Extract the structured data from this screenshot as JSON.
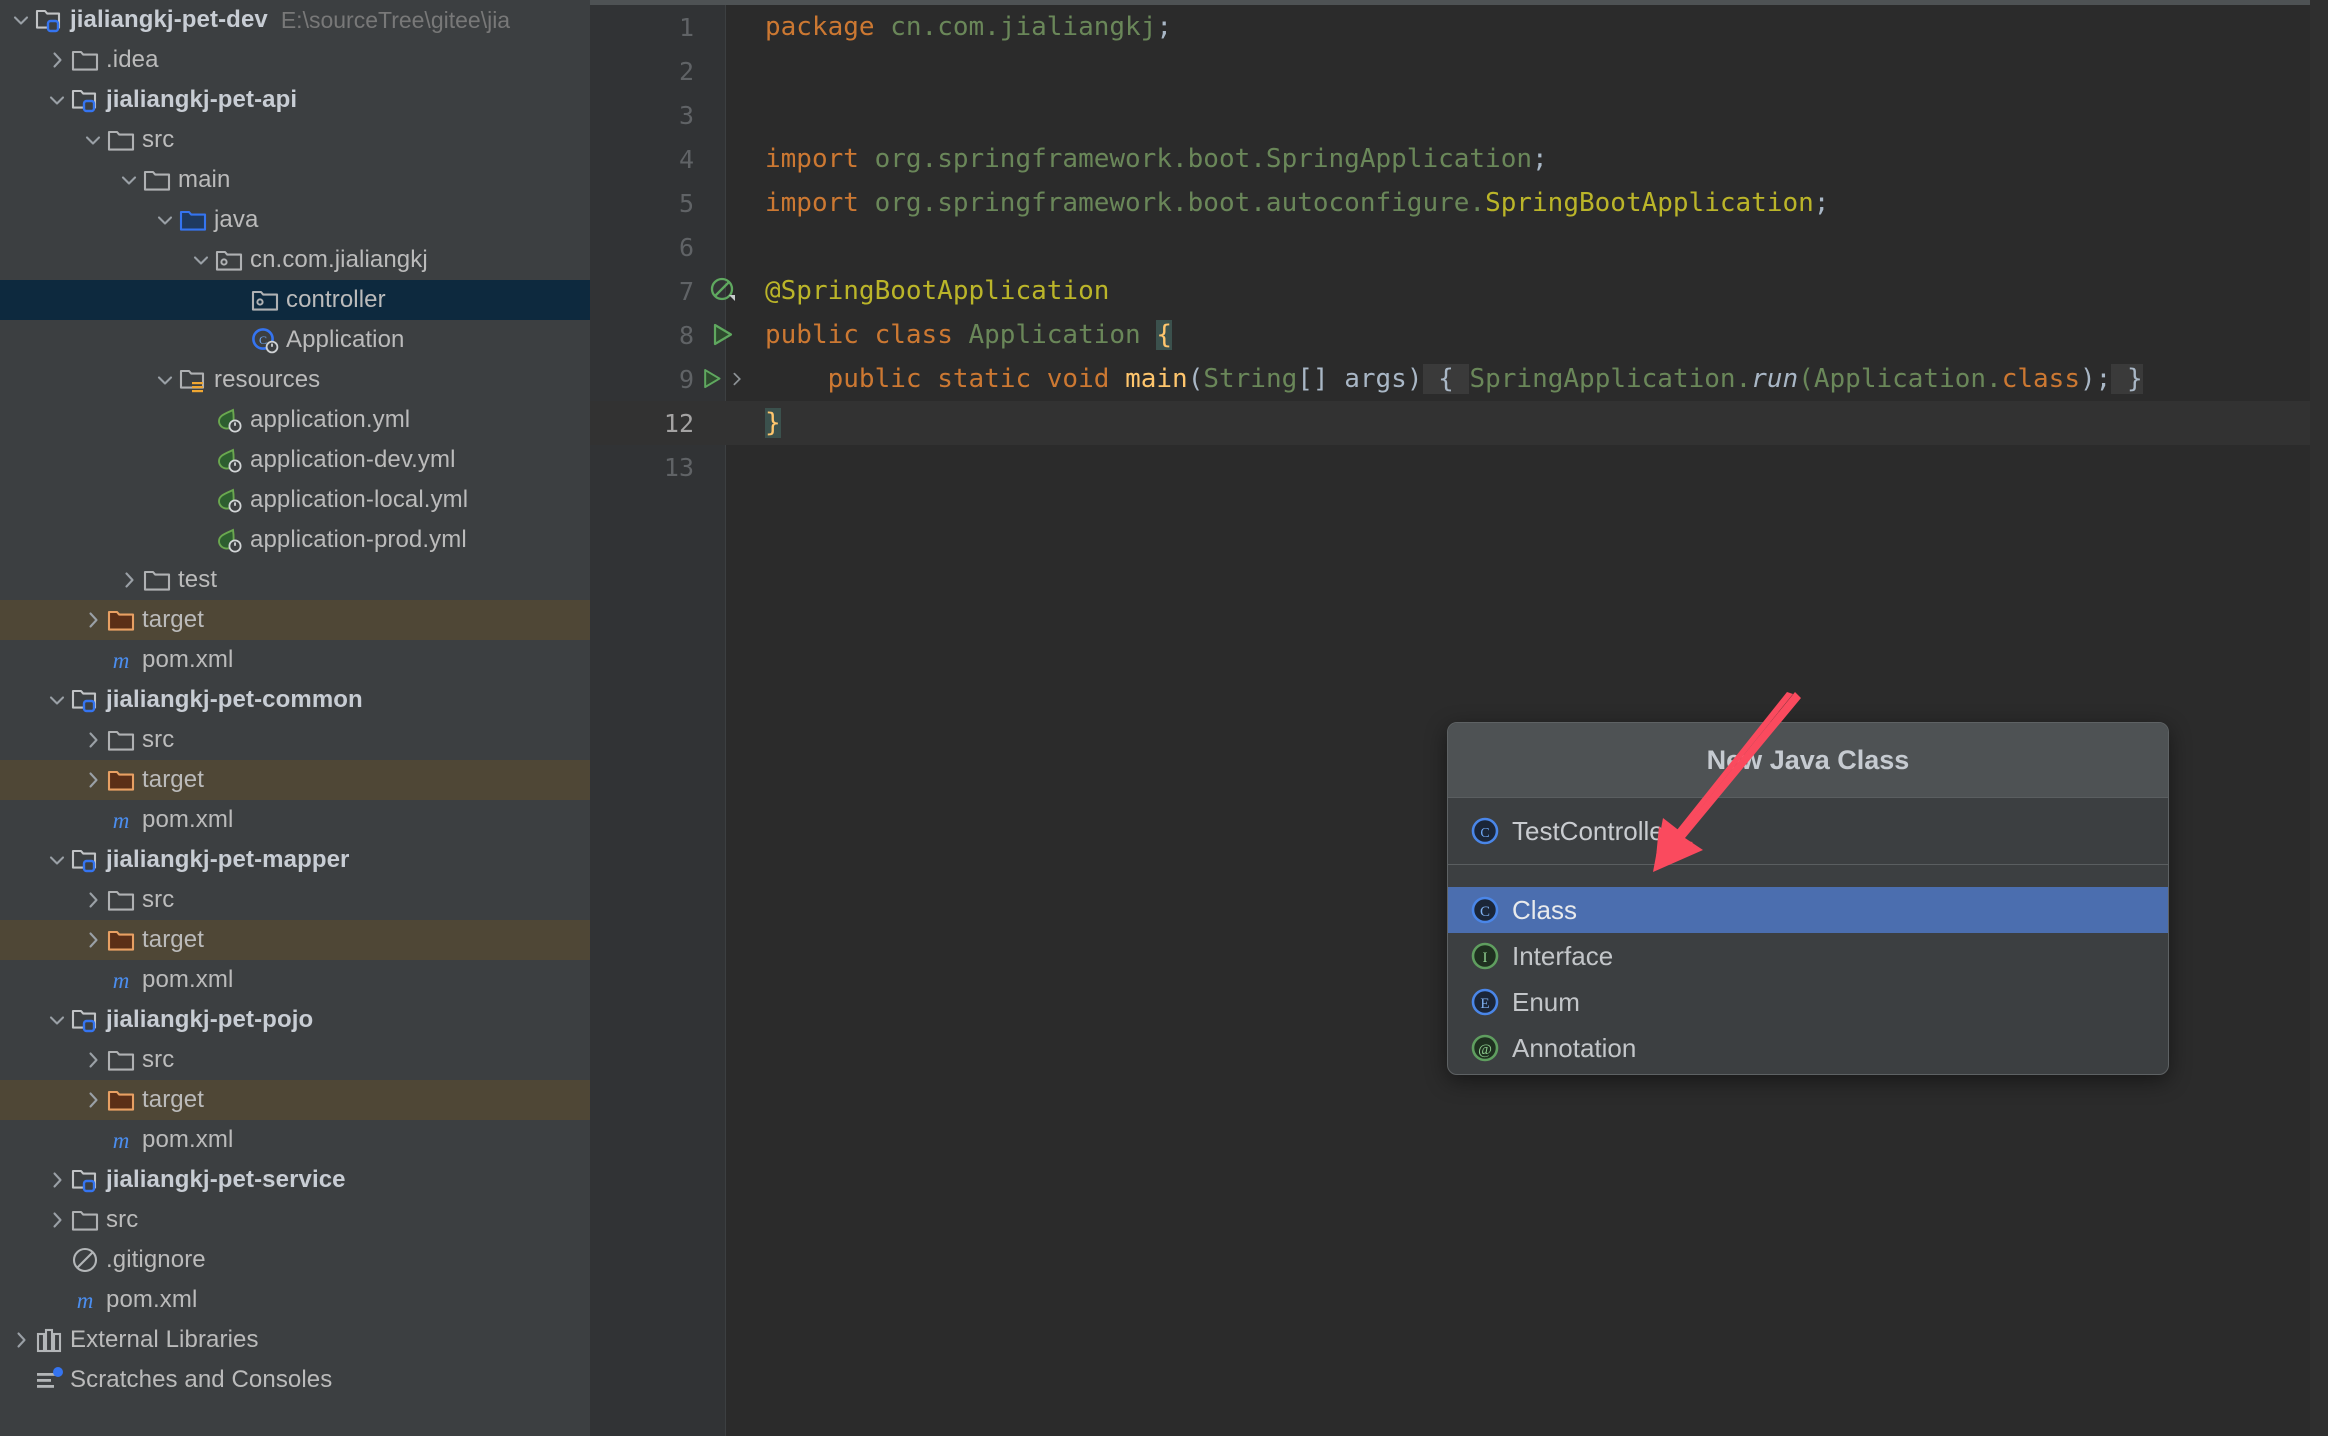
{
  "sidebar": {
    "name": "project-tree",
    "root": {
      "label": "jialiangkj-pet-dev",
      "path": "E:\\sourceTree\\gitee\\jia"
    },
    "items": [
      {
        "label": "jialiangkj-pet-dev",
        "path": "E:\\sourceTree\\gitee\\jia",
        "icon": "module-folder-icon",
        "indent": 0,
        "twisty": "down",
        "state": "normal",
        "bold": true
      },
      {
        "label": ".idea",
        "icon": "folder-icon",
        "indent": 1,
        "twisty": "right",
        "state": "normal"
      },
      {
        "label": "jialiangkj-pet-api",
        "icon": "module-folder-icon",
        "indent": 1,
        "twisty": "down",
        "state": "normal",
        "bold": true
      },
      {
        "label": "src",
        "icon": "folder-icon",
        "indent": 2,
        "twisty": "down",
        "state": "normal"
      },
      {
        "label": "main",
        "icon": "folder-icon",
        "indent": 3,
        "twisty": "down",
        "state": "normal"
      },
      {
        "label": "java",
        "icon": "source-root-folder-icon",
        "indent": 4,
        "twisty": "down",
        "state": "normal"
      },
      {
        "label": "cn.com.jialiangkj",
        "icon": "package-icon",
        "indent": 5,
        "twisty": "down",
        "state": "normal"
      },
      {
        "label": "controller",
        "icon": "package-icon",
        "indent": 6,
        "twisty": "none",
        "state": "selected"
      },
      {
        "label": "Application",
        "icon": "spring-class-icon",
        "indent": 6,
        "twisty": "none",
        "state": "normal"
      },
      {
        "label": "resources",
        "icon": "resources-folder-icon",
        "indent": 4,
        "twisty": "down",
        "state": "normal"
      },
      {
        "label": "application.yml",
        "icon": "spring-yaml-icon",
        "indent": 5,
        "twisty": "none",
        "state": "normal"
      },
      {
        "label": "application-dev.yml",
        "icon": "spring-yaml-icon",
        "indent": 5,
        "twisty": "none",
        "state": "normal"
      },
      {
        "label": "application-local.yml",
        "icon": "spring-yaml-icon",
        "indent": 5,
        "twisty": "none",
        "state": "normal"
      },
      {
        "label": "application-prod.yml",
        "icon": "spring-yaml-icon",
        "indent": 5,
        "twisty": "none",
        "state": "normal"
      },
      {
        "label": "test",
        "icon": "folder-icon",
        "indent": 3,
        "twisty": "right",
        "state": "normal"
      },
      {
        "label": "target",
        "icon": "excluded-folder-icon",
        "indent": 2,
        "twisty": "right",
        "state": "excluded"
      },
      {
        "label": "pom.xml",
        "icon": "maven-icon",
        "indent": 2,
        "twisty": "none",
        "state": "normal"
      },
      {
        "label": "jialiangkj-pet-common",
        "icon": "module-folder-icon",
        "indent": 1,
        "twisty": "down",
        "state": "normal",
        "bold": true
      },
      {
        "label": "src",
        "icon": "folder-icon",
        "indent": 2,
        "twisty": "right",
        "state": "normal"
      },
      {
        "label": "target",
        "icon": "excluded-folder-icon",
        "indent": 2,
        "twisty": "right",
        "state": "excluded"
      },
      {
        "label": "pom.xml",
        "icon": "maven-icon",
        "indent": 2,
        "twisty": "none",
        "state": "normal"
      },
      {
        "label": "jialiangkj-pet-mapper",
        "icon": "module-folder-icon",
        "indent": 1,
        "twisty": "down",
        "state": "normal",
        "bold": true
      },
      {
        "label": "src",
        "icon": "folder-icon",
        "indent": 2,
        "twisty": "right",
        "state": "normal"
      },
      {
        "label": "target",
        "icon": "excluded-folder-icon",
        "indent": 2,
        "twisty": "right",
        "state": "excluded"
      },
      {
        "label": "pom.xml",
        "icon": "maven-icon",
        "indent": 2,
        "twisty": "none",
        "state": "normal"
      },
      {
        "label": "jialiangkj-pet-pojo",
        "icon": "module-folder-icon",
        "indent": 1,
        "twisty": "down",
        "state": "normal",
        "bold": true
      },
      {
        "label": "src",
        "icon": "folder-icon",
        "indent": 2,
        "twisty": "right",
        "state": "normal"
      },
      {
        "label": "target",
        "icon": "excluded-folder-icon",
        "indent": 2,
        "twisty": "right",
        "state": "excluded"
      },
      {
        "label": "pom.xml",
        "icon": "maven-icon",
        "indent": 2,
        "twisty": "none",
        "state": "normal"
      },
      {
        "label": "jialiangkj-pet-service",
        "icon": "module-folder-icon",
        "indent": 1,
        "twisty": "right",
        "state": "normal",
        "bold": true
      },
      {
        "label": "src",
        "icon": "folder-icon",
        "indent": 1,
        "twisty": "right",
        "state": "normal"
      },
      {
        "label": ".gitignore",
        "icon": "gitignore-icon",
        "indent": 1,
        "twisty": "none",
        "state": "normal"
      },
      {
        "label": "pom.xml",
        "icon": "maven-icon",
        "indent": 1,
        "twisty": "none",
        "state": "normal"
      },
      {
        "label": "External Libraries",
        "icon": "library-icon",
        "indent": 0,
        "twisty": "right",
        "state": "normal"
      },
      {
        "label": "Scratches and Consoles",
        "icon": "scratches-icon",
        "indent": 0,
        "twisty": "none",
        "state": "normal"
      }
    ]
  },
  "editor": {
    "name": "code-editor",
    "current_line": 12,
    "lines": [
      {
        "no": "1",
        "gutter": "none",
        "tokens": [
          {
            "t": "package ",
            "c": "kw"
          },
          {
            "t": "cn.com.jialiangkj",
            "c": "pkg"
          },
          {
            "t": ";",
            "c": "semi"
          }
        ]
      },
      {
        "no": "2",
        "gutter": "none",
        "tokens": []
      },
      {
        "no": "3",
        "gutter": "none",
        "tokens": []
      },
      {
        "no": "4",
        "gutter": "none",
        "tokens": [
          {
            "t": "import ",
            "c": "kw"
          },
          {
            "t": "org.springframework.boot.SpringApplication",
            "c": "pkg"
          },
          {
            "t": ";",
            "c": "semi"
          }
        ]
      },
      {
        "no": "5",
        "gutter": "none",
        "tokens": [
          {
            "t": "import ",
            "c": "kw"
          },
          {
            "t": "org.springframework.boot.autoconfigure.",
            "c": "pkg"
          },
          {
            "t": "SpringBootApplication",
            "c": "anno"
          },
          {
            "t": ";",
            "c": "semi"
          }
        ]
      },
      {
        "no": "6",
        "gutter": "none",
        "tokens": []
      },
      {
        "no": "7",
        "gutter": "suppress-icon",
        "tokens": [
          {
            "t": "@SpringBootApplication",
            "c": "anno"
          }
        ]
      },
      {
        "no": "8",
        "gutter": "run-icon",
        "tokens": [
          {
            "t": "public ",
            "c": "kw"
          },
          {
            "t": "class ",
            "c": "kw"
          },
          {
            "t": "Application ",
            "c": "pkg"
          },
          {
            "t": "{",
            "c": "brc-hl"
          }
        ]
      },
      {
        "no": "9",
        "gutter": "run-fold-icon",
        "tokens": [
          {
            "t": "    ",
            "c": "ident"
          },
          {
            "t": "public ",
            "c": "kw"
          },
          {
            "t": "static ",
            "c": "kw"
          },
          {
            "t": "void ",
            "c": "kw"
          },
          {
            "t": "main",
            "c": "meth"
          },
          {
            "t": "(",
            "c": "ident"
          },
          {
            "t": "String",
            "c": "pkg"
          },
          {
            "t": "[] args)",
            "c": "ident"
          },
          {
            "t": " { ",
            "c": "brc-g"
          },
          {
            "t": "SpringApplication.",
            "c": "pkg"
          },
          {
            "t": "run",
            "c": "ital"
          },
          {
            "t": "(Application.",
            "c": "pkg"
          },
          {
            "t": "class",
            "c": "kw"
          },
          {
            "t": ");",
            "c": "ident"
          },
          {
            "t": " }",
            "c": "brc-g"
          }
        ]
      },
      {
        "no": "12",
        "gutter": "none",
        "current": true,
        "tokens": [
          {
            "t": "}",
            "c": "brc-hl"
          }
        ]
      },
      {
        "no": "13",
        "gutter": "none",
        "tokens": []
      }
    ]
  },
  "popup": {
    "name": "new-java-class-popup",
    "title": "New Java Class",
    "input_value": "TestController",
    "input_icon": "class-icon",
    "options": [
      {
        "label": "Class",
        "icon": "class-icon",
        "selected": true
      },
      {
        "label": "Interface",
        "icon": "interface-icon",
        "selected": false
      },
      {
        "label": "Enum",
        "icon": "enum-icon",
        "selected": false
      },
      {
        "label": "Annotation",
        "icon": "annotation-icon",
        "selected": false
      }
    ]
  },
  "annotation": {
    "name": "arrow-annotation",
    "icon": "red-arrow-icon",
    "color": "#fa4a5e"
  },
  "colors": {
    "sidebar_bg": "#3c3f41",
    "editor_bg": "#2b2b2b",
    "gutter_bg": "#313335",
    "selection_bg": "#0d293e",
    "excluded_bg": "#4f4736",
    "popup_bg": "#3c3f41",
    "popup_header_bg": "#4e5254",
    "popup_selected_bg": "#4b6eaf",
    "arrow": "#fa4a5e"
  }
}
